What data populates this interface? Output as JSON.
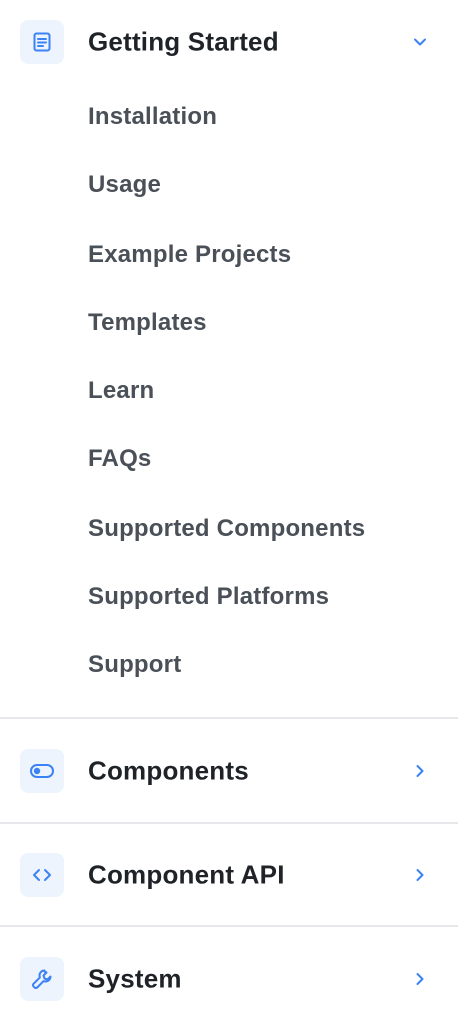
{
  "accent_color": "#3b82f6",
  "sections": [
    {
      "title": "Getting Started",
      "icon": "document-icon",
      "expanded": true,
      "items": [
        "Installation",
        "Usage",
        "Example Projects",
        "Templates",
        "Learn",
        "FAQs",
        "Supported Components",
        "Supported Platforms",
        "Support"
      ]
    },
    {
      "title": "Components",
      "icon": "toggle-icon",
      "expanded": false
    },
    {
      "title": "Component API",
      "icon": "code-icon",
      "expanded": false
    },
    {
      "title": "System",
      "icon": "wrench-icon",
      "expanded": false
    }
  ]
}
